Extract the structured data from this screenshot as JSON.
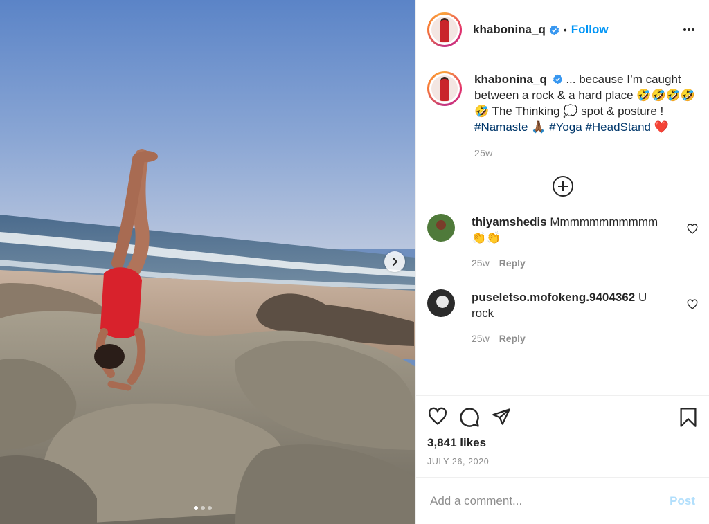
{
  "user": {
    "username": "khabonina_q",
    "verified": true,
    "follow_label": "Follow",
    "separator": "•"
  },
  "caption": {
    "username": "khabonina_q",
    "text_parts": [
      "... because I’m caught between a rock & a hard place 🤣🤣🤣🤣🤣 The Thinking 💭 spot & posture ! ",
      "#Namaste",
      " 🙏🏾 ",
      "#Yoga",
      " ",
      "#HeadStand",
      " ❤️"
    ],
    "time": "25w"
  },
  "comments": [
    {
      "username": "thiyamshedis",
      "text": " Mmmmmmmmmmm 👏👏",
      "time": "25w",
      "reply_label": "Reply"
    },
    {
      "username": "puseletso.mofokeng.9404362",
      "text": " U rock",
      "time": "25w",
      "reply_label": "Reply"
    }
  ],
  "stats": {
    "likes": "3,841 likes",
    "date": "JULY 26, 2020"
  },
  "composer": {
    "placeholder": "Add a comment...",
    "post_label": "Post"
  },
  "carousel": {
    "slides": 3,
    "active": 1
  },
  "colors": {
    "link": "#00376b",
    "accent": "#0095f6",
    "post_disabled": "#b2dffc",
    "muted": "#8e8e8e"
  },
  "icons": [
    "verified-icon",
    "more-icon",
    "load-more-icon",
    "heart-icon",
    "comment-icon",
    "share-icon",
    "bookmark-icon",
    "chevron-right-icon"
  ]
}
